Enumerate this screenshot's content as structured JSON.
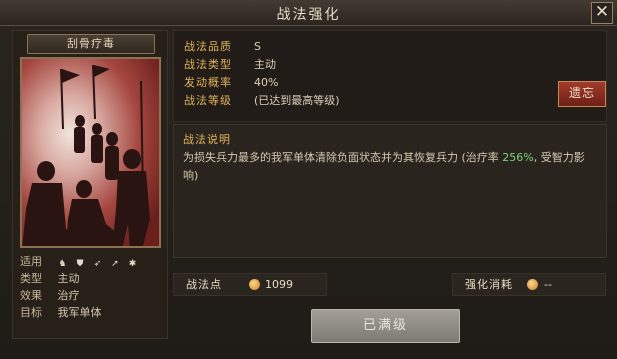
{
  "window": {
    "title": "战法强化"
  },
  "card": {
    "name": "刮骨疗毒",
    "stats": [
      {
        "label": "适用",
        "icons": [
          "cavalry-icon",
          "shield-icon",
          "bow-icon",
          "spear-icon",
          "siege-icon"
        ]
      },
      {
        "label": "类型",
        "value": "主动"
      },
      {
        "label": "效果",
        "value": "治疗"
      },
      {
        "label": "目标",
        "value": "我军单体"
      }
    ]
  },
  "info": {
    "rows": [
      {
        "label": "战法品质",
        "value": "S"
      },
      {
        "label": "战法类型",
        "value": "主动"
      },
      {
        "label": "发动概率",
        "value": "40%"
      },
      {
        "label": "战法等级",
        "value": "(已达到最高等级)"
      }
    ],
    "forget_label": "遗忘"
  },
  "description": {
    "title": "战法说明",
    "text_before": "为损失兵力最多的我军单体清除负面状态并为其恢复兵力 (治疗率 ",
    "highlight": "256%",
    "text_after": ", 受智力影响)"
  },
  "points": {
    "label": "战法点",
    "value": "1099"
  },
  "cost": {
    "label": "强化消耗",
    "value": "--"
  },
  "action": {
    "maxed_label": "已满级"
  },
  "colors": {
    "accent_gold": "#e0b35a",
    "highlight_green": "#7bd07c",
    "forget_red": "#a23b2a"
  }
}
